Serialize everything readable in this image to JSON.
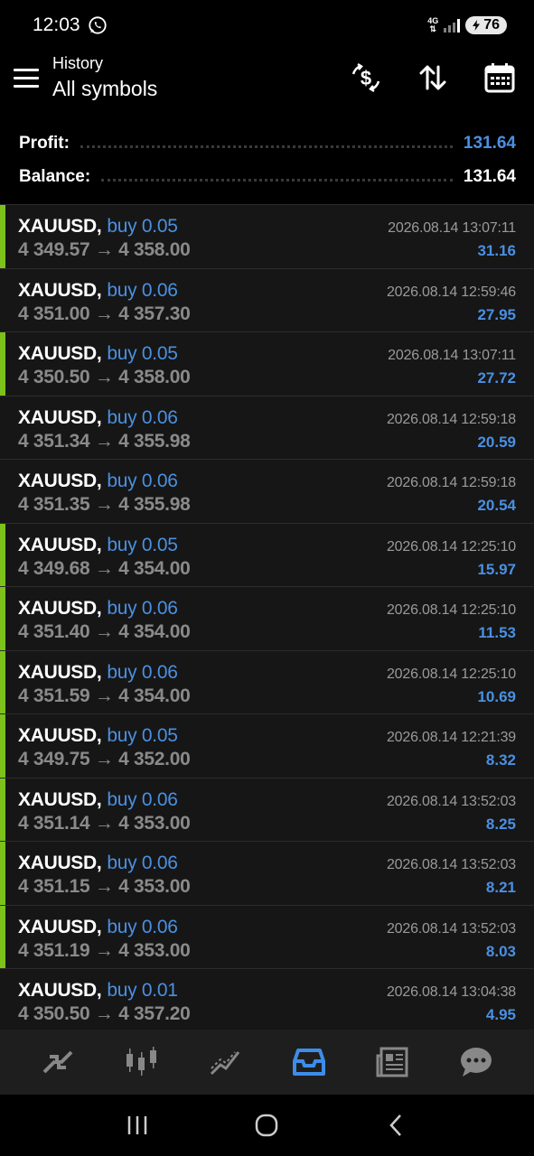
{
  "status_bar": {
    "time": "12:03",
    "network": "4G",
    "battery": "76"
  },
  "app_bar": {
    "title": "History",
    "subtitle": "All symbols"
  },
  "summary": {
    "profit_label": "Profit:",
    "profit_value": "131.64",
    "balance_label": "Balance:",
    "balance_value": "131.64"
  },
  "trades": [
    {
      "symbol": "XAUUSD,",
      "side": "buy 0.05",
      "datetime": "2026.08.14 13:07:11",
      "prices": "4 349.57 → 4 358.00",
      "profit": "31.16",
      "indicator": true
    },
    {
      "symbol": "XAUUSD,",
      "side": "buy 0.06",
      "datetime": "2026.08.14 12:59:46",
      "prices": "4 351.00 → 4 357.30",
      "profit": "27.95",
      "indicator": false
    },
    {
      "symbol": "XAUUSD,",
      "side": "buy 0.05",
      "datetime": "2026.08.14 13:07:11",
      "prices": "4 350.50 → 4 358.00",
      "profit": "27.72",
      "indicator": true
    },
    {
      "symbol": "XAUUSD,",
      "side": "buy 0.06",
      "datetime": "2026.08.14 12:59:18",
      "prices": "4 351.34 → 4 355.98",
      "profit": "20.59",
      "indicator": false
    },
    {
      "symbol": "XAUUSD,",
      "side": "buy 0.06",
      "datetime": "2026.08.14 12:59:18",
      "prices": "4 351.35 → 4 355.98",
      "profit": "20.54",
      "indicator": false
    },
    {
      "symbol": "XAUUSD,",
      "side": "buy 0.05",
      "datetime": "2026.08.14 12:25:10",
      "prices": "4 349.68 → 4 354.00",
      "profit": "15.97",
      "indicator": true
    },
    {
      "symbol": "XAUUSD,",
      "side": "buy 0.06",
      "datetime": "2026.08.14 12:25:10",
      "prices": "4 351.40 → 4 354.00",
      "profit": "11.53",
      "indicator": true
    },
    {
      "symbol": "XAUUSD,",
      "side": "buy 0.06",
      "datetime": "2026.08.14 12:25:10",
      "prices": "4 351.59 → 4 354.00",
      "profit": "10.69",
      "indicator": true
    },
    {
      "symbol": "XAUUSD,",
      "side": "buy 0.05",
      "datetime": "2026.08.14 12:21:39",
      "prices": "4 349.75 → 4 352.00",
      "profit": "8.32",
      "indicator": true
    },
    {
      "symbol": "XAUUSD,",
      "side": "buy 0.06",
      "datetime": "2026.08.14 13:52:03",
      "prices": "4 351.14 → 4 353.00",
      "profit": "8.25",
      "indicator": true
    },
    {
      "symbol": "XAUUSD,",
      "side": "buy 0.06",
      "datetime": "2026.08.14 13:52:03",
      "prices": "4 351.15 → 4 353.00",
      "profit": "8.21",
      "indicator": true
    },
    {
      "symbol": "XAUUSD,",
      "side": "buy 0.06",
      "datetime": "2026.08.14 13:52:03",
      "prices": "4 351.19 → 4 353.00",
      "profit": "8.03",
      "indicator": true
    },
    {
      "symbol": "XAUUSD,",
      "side": "buy 0.01",
      "datetime": "2026.08.14 13:04:38",
      "prices": "4 350.50 → 4 357.20",
      "profit": "4.95",
      "indicator": false
    }
  ],
  "bottom_nav": [
    "quotes-icon",
    "chart-icon",
    "trade-icon",
    "history-icon",
    "news-icon",
    "chat-icon"
  ],
  "bottom_nav_active": "history-icon",
  "colors": {
    "accent": "#4a90e2",
    "indicator": "#7cc21a",
    "background": "#161616",
    "nav_background": "#1e1e1e"
  }
}
